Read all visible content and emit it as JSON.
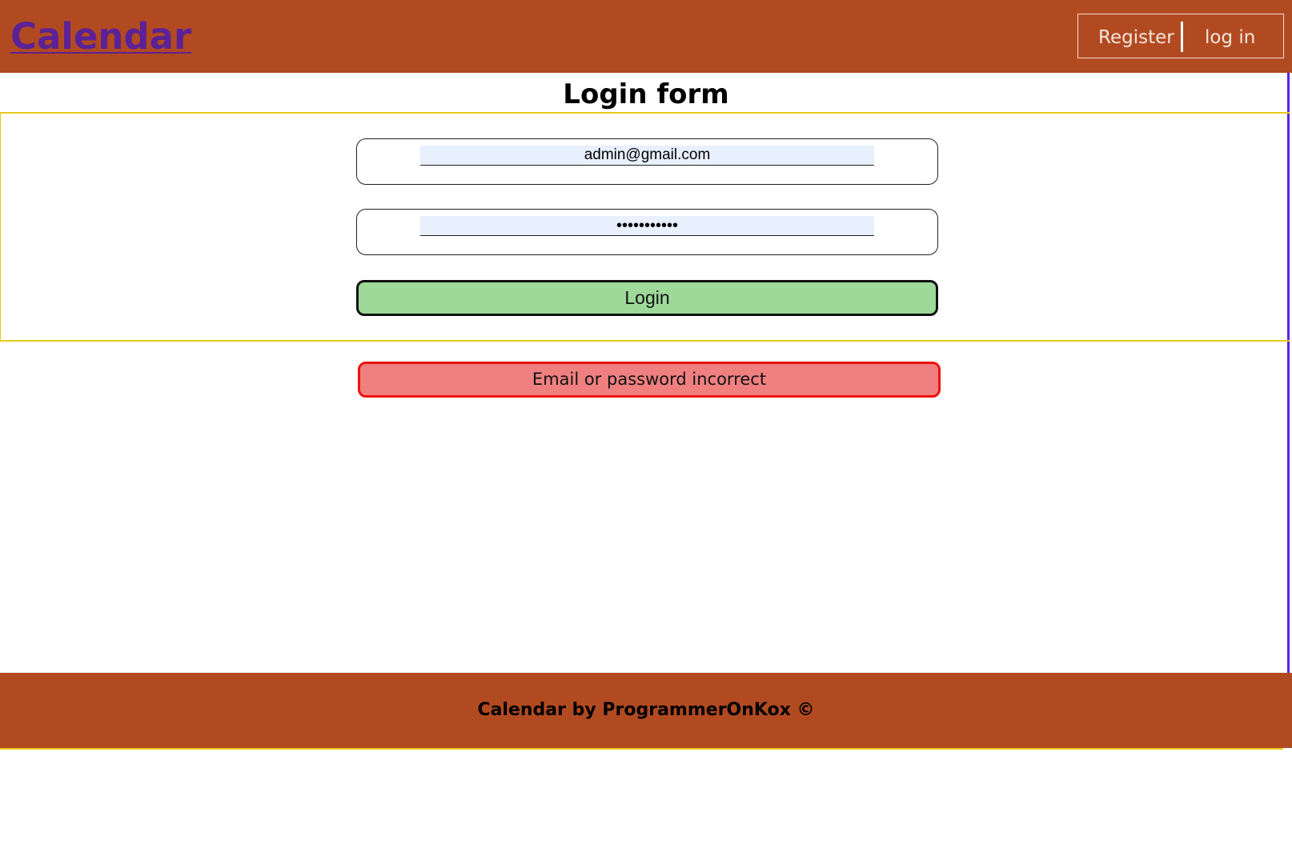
{
  "header": {
    "brand": "Calendar",
    "nav": {
      "register": "Register",
      "login": "log in"
    }
  },
  "page": {
    "title": "Login form"
  },
  "form": {
    "email_value": "admin@gmail.com",
    "password_value": "•••••••••••",
    "submit_label": "Login"
  },
  "error": {
    "message": "Email or password incorrect"
  },
  "footer": {
    "text": "Calendar by ProgrammerOnKox ©"
  },
  "colors": {
    "header_bg": "#b24a21",
    "brand_link": "#5b2196",
    "panel_border": "#e8c81c",
    "input_bg": "#e8f0fe",
    "button_bg": "#9ed99a",
    "error_bg": "#f08080",
    "error_border": "#ee1111"
  }
}
